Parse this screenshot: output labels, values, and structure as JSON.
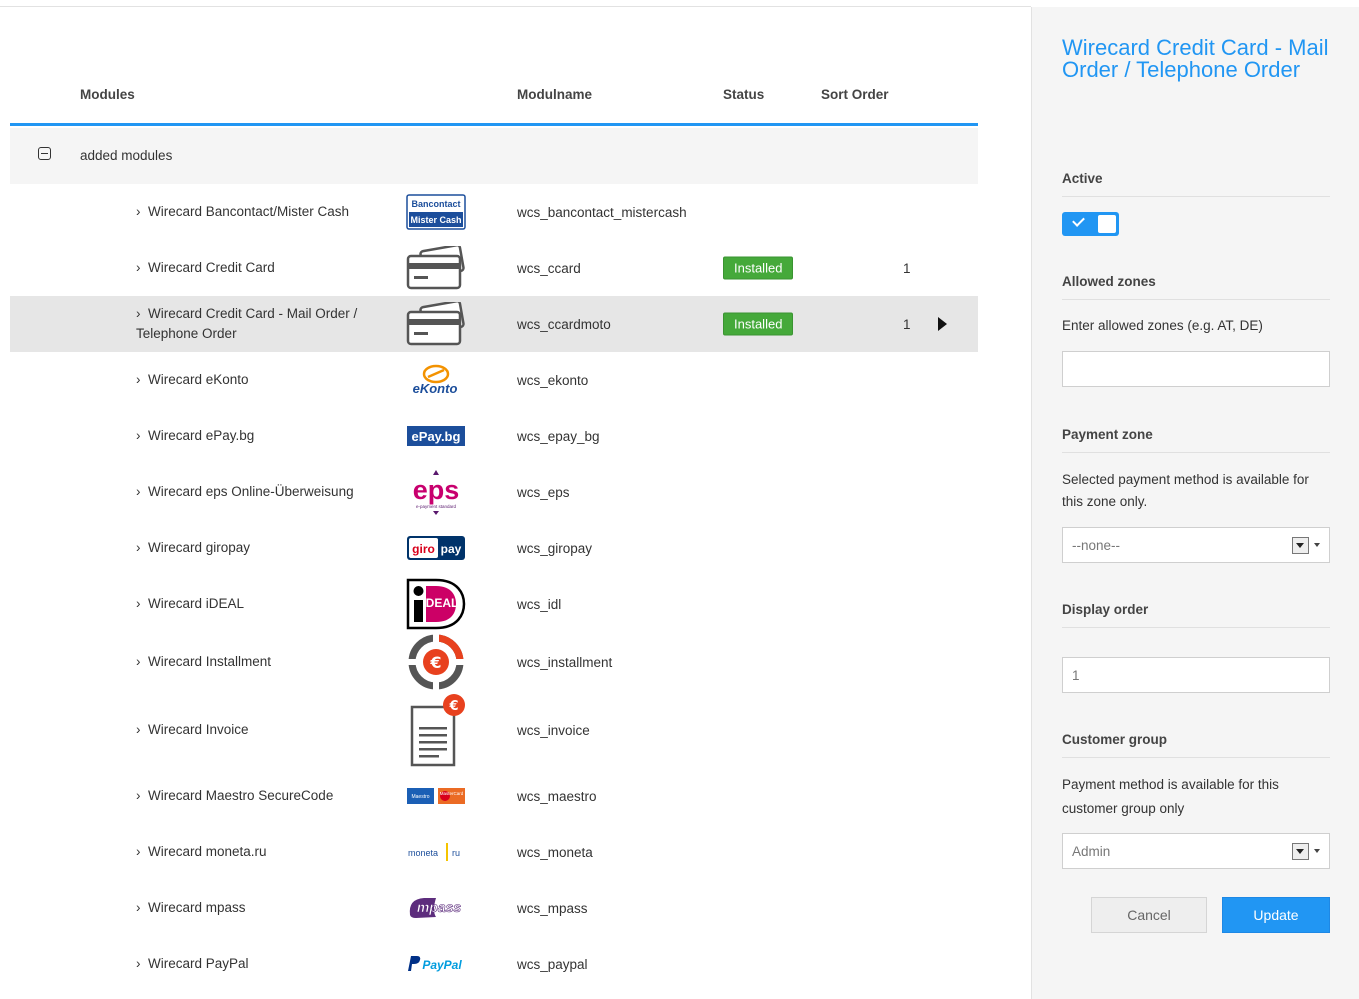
{
  "table": {
    "headers": {
      "modules": "Modules",
      "modulname": "Modulname",
      "status": "Status",
      "sort_order": "Sort Order"
    },
    "group_label": "added modules",
    "rows": [
      {
        "name": "Wirecard Bancontact/Mister Cash",
        "modulname": "wcs_bancontact_mistercash",
        "status": "",
        "sort": "",
        "logo": "bancontact-logo"
      },
      {
        "name": "Wirecard Credit Card",
        "modulname": "wcs_ccard",
        "status": "Installed",
        "sort": "1",
        "logo": "credit-card-logo"
      },
      {
        "name": "Wirecard Credit Card - Mail Order / Telephone Order",
        "modulname": "wcs_ccardmoto",
        "status": "Installed",
        "sort": "1",
        "logo": "credit-card-logo",
        "selected": true
      },
      {
        "name": "Wirecard eKonto",
        "modulname": "wcs_ekonto",
        "status": "",
        "sort": "",
        "logo": "ekonto-logo"
      },
      {
        "name": "Wirecard ePay.bg",
        "modulname": "wcs_epay_bg",
        "status": "",
        "sort": "",
        "logo": "epay-logo"
      },
      {
        "name": "Wirecard eps Online-Überweisung",
        "modulname": "wcs_eps",
        "status": "",
        "sort": "",
        "logo": "eps-logo"
      },
      {
        "name": "Wirecard giropay",
        "modulname": "wcs_giropay",
        "status": "",
        "sort": "",
        "logo": "giropay-logo"
      },
      {
        "name": "Wirecard iDEAL",
        "modulname": "wcs_idl",
        "status": "",
        "sort": "",
        "logo": "ideal-logo"
      },
      {
        "name": "Wirecard Installment",
        "modulname": "wcs_installment",
        "status": "",
        "sort": "",
        "logo": "installment-logo"
      },
      {
        "name": "Wirecard Invoice",
        "modulname": "wcs_invoice",
        "status": "",
        "sort": "",
        "logo": "invoice-logo"
      },
      {
        "name": "Wirecard Maestro SecureCode",
        "modulname": "wcs_maestro",
        "status": "",
        "sort": "",
        "logo": "maestro-logo"
      },
      {
        "name": "Wirecard moneta.ru",
        "modulname": "wcs_moneta",
        "status": "",
        "sort": "",
        "logo": "moneta-logo"
      },
      {
        "name": "Wirecard mpass",
        "modulname": "wcs_mpass",
        "status": "",
        "sort": "",
        "logo": "mpass-logo"
      },
      {
        "name": "Wirecard PayPal",
        "modulname": "wcs_paypal",
        "status": "",
        "sort": "",
        "logo": "paypal-logo"
      }
    ]
  },
  "logos": {
    "bancontact_top": "Bancontact",
    "bancontact_bottom": "Mister Cash",
    "ekonto": "eKonto",
    "epay": "ePay.bg",
    "eps": "eps",
    "eps_sub": "e-payment standard",
    "giro": "giro",
    "pay": "pay",
    "ideal": "DEAL",
    "euro": "€",
    "maestro_a": "Maestro",
    "maestro_b": "MasterCard",
    "moneta_a": "moneta",
    "moneta_b": "ru",
    "mpass": "mpass",
    "paypal": "PayPal"
  },
  "panel": {
    "title": "Wirecard Credit Card - Mail Order / Telephone Order",
    "active_label": "Active",
    "active": true,
    "zones_label": "Allowed zones",
    "zones_desc": "Enter allowed zones (e.g. AT, DE)",
    "zones_value": "",
    "payment_zone_label": "Payment zone",
    "payment_zone_desc": "Selected payment method is available for this zone only.",
    "payment_zone_value": "--none--",
    "display_order_label": "Display order",
    "display_order_value": "1",
    "customer_group_label": "Customer group",
    "customer_group_desc": "Payment method is available for this customer group only",
    "customer_group_value": "Admin",
    "cancel_label": "Cancel",
    "update_label": "Update"
  },
  "colors": {
    "accent": "#2196f3",
    "installed": "#45a93a",
    "selected_row": "#e6e6e6"
  }
}
